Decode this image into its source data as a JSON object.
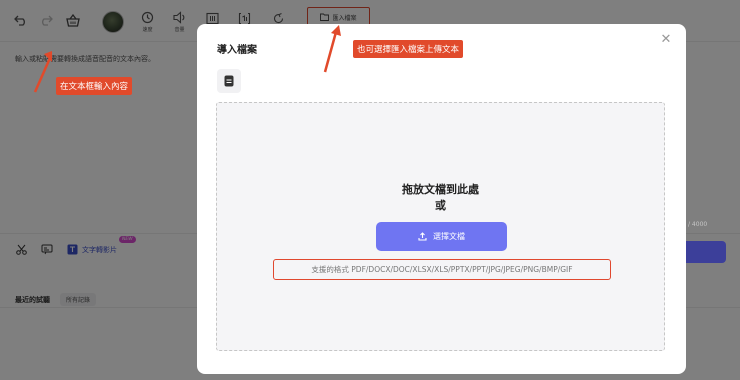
{
  "toolbar": {
    "speed_label": "速度",
    "volume_label": "音量",
    "import_label": "匯入檔案"
  },
  "editor": {
    "hint": "輸入或粘貼需要轉換成語音配音的文本內容。",
    "counter": "/ 4000"
  },
  "bottom_tools": {
    "text_to_video_label": "文字轉影片",
    "new_badge": "NEW"
  },
  "recent": {
    "title": "最近的試聽",
    "all_records": "所有記錄"
  },
  "modal": {
    "title": "導入檔案",
    "close_glyph": "✕",
    "drop_title": "拖放文檔到此處",
    "drop_or": "或",
    "choose_button": "選擇文檔",
    "formats": "支援的格式 PDF/DOCX/DOC/XLSX/XLS/PPTX/PPT/JPG/JPEG/PNG/BMP/GIF"
  },
  "annotations": {
    "text_box": "在文本框輸入內容",
    "import_hint": "也可選擇匯入檔案上傳文本"
  },
  "colors": {
    "accent": "#6f75f2",
    "annotation": "#e14a2b",
    "brand_link": "#3b4ec9"
  }
}
